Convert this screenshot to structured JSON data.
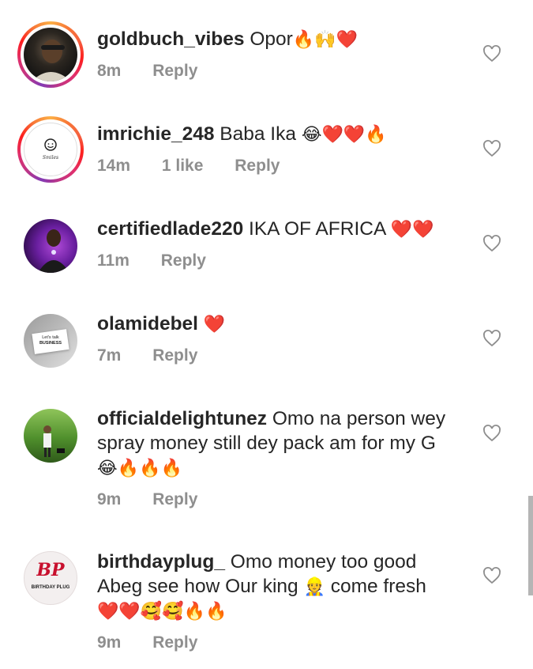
{
  "reply_label": "Reply",
  "comments": [
    {
      "username": "goldbuch_vibes",
      "text": "Opor",
      "emoji": "🔥🙌❤️",
      "time": "8m",
      "likes": ""
    },
    {
      "username": "imrichie_248",
      "text": "Baba Ika",
      "emoji": "😂❤️❤️🔥",
      "time": "14m",
      "likes": "1 like",
      "avatar_text": "Smiles"
    },
    {
      "username": "certifiedlade220",
      "text": "IKA OF AFRICA",
      "emoji": "❤️❤️",
      "time": "11m",
      "likes": ""
    },
    {
      "username": "olamidebel",
      "text": "",
      "emoji": "❤️",
      "time": "7m",
      "likes": "",
      "avatar_text_1": "Let's talk",
      "avatar_text_2": "BUSINESS"
    },
    {
      "username": "officialdelightunez",
      "text_line1": "Omo na person wey",
      "text_line2": "spray money still dey pack am for my G",
      "emoji": "😂🔥🔥🔥",
      "time": "9m",
      "likes": ""
    },
    {
      "username": "birthdayplug_",
      "text_line1": "Omo money too good",
      "text_line2a": "Abeg see how Our king",
      "text_line2_emoji": "👷",
      "text_line2b": "come fresh",
      "emoji": "❤️❤️🥰🥰🔥🔥",
      "time": "9m",
      "likes": "",
      "avatar_text": "BIRTHDAY PLUG",
      "avatar_logo": "BP"
    }
  ],
  "colors": {
    "meta": "#8e8e8e",
    "text": "#262626",
    "ring_start": "#fcaf45",
    "ring_end": "#c13584"
  }
}
